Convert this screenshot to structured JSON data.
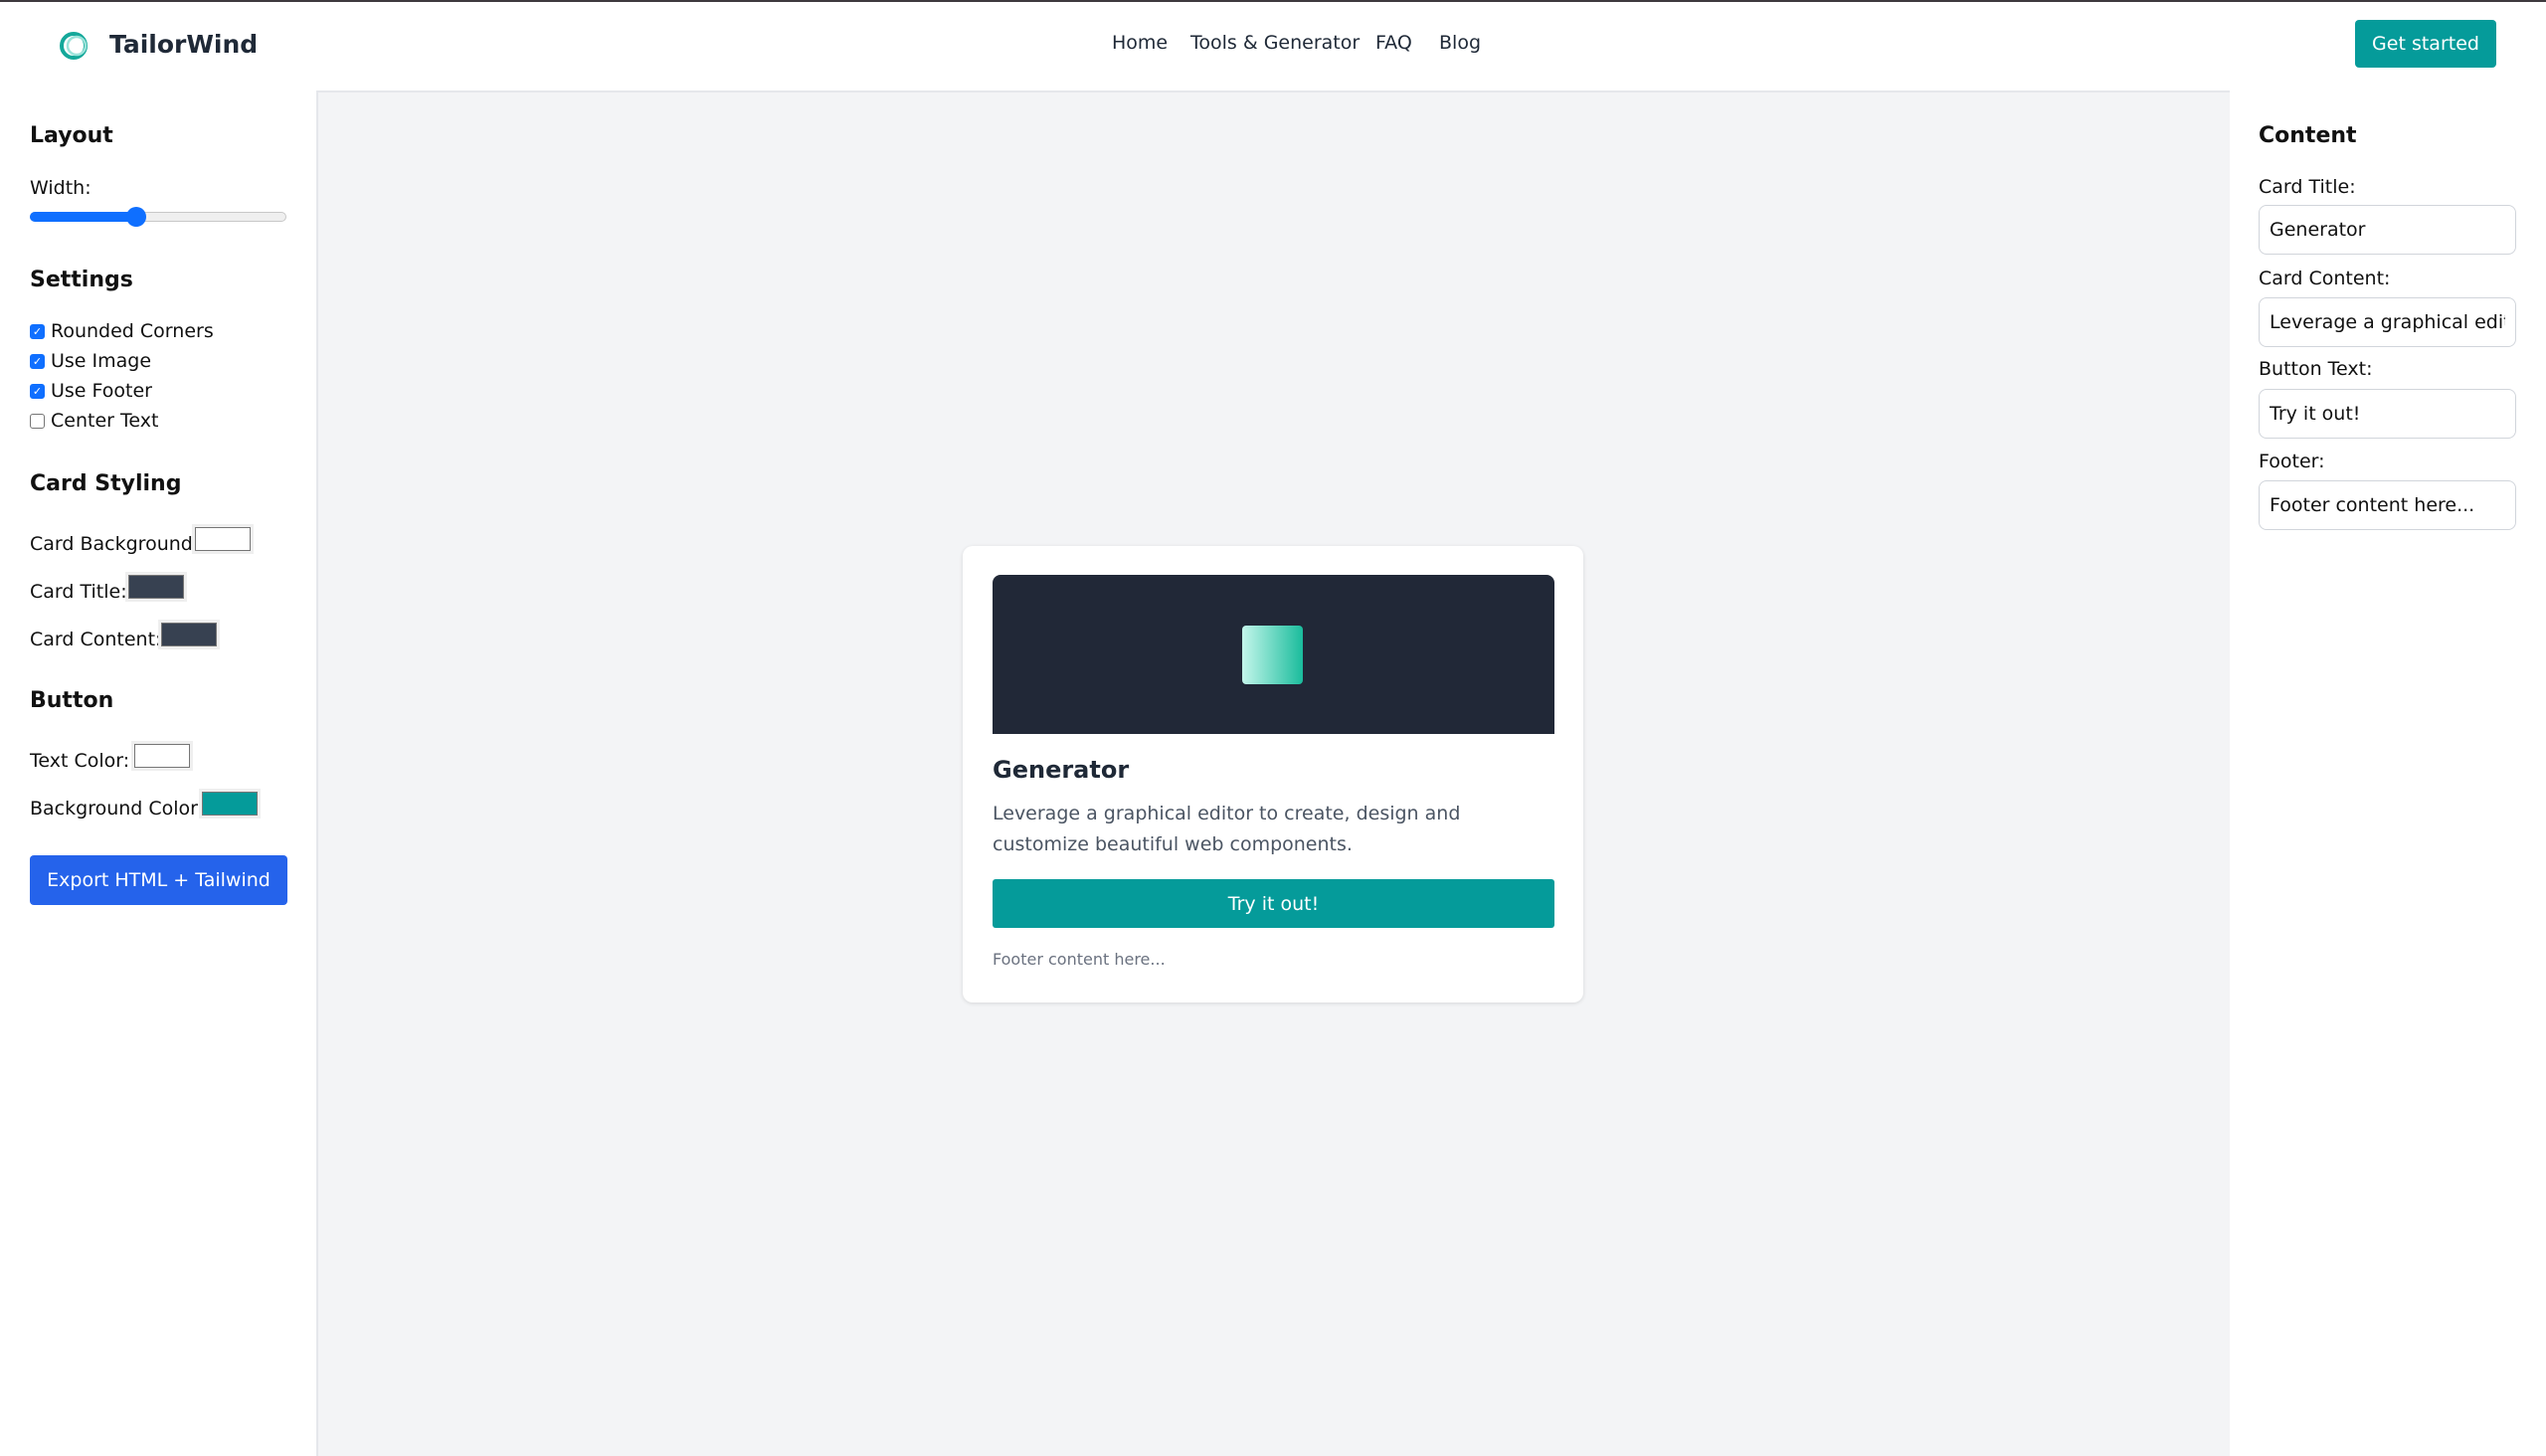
{
  "header": {
    "brand": "TailorWind",
    "nav": [
      "Home",
      "Tools & Generator",
      "FAQ",
      "Blog"
    ],
    "cta": "Get started",
    "accent": "#059b9a"
  },
  "left": {
    "layout_heading": "Layout",
    "width_label": "Width:",
    "width_value_percent": 40,
    "settings_heading": "Settings",
    "settings": [
      {
        "label": "Rounded Corners",
        "checked": true
      },
      {
        "label": "Use Image",
        "checked": true
      },
      {
        "label": "Use Footer",
        "checked": true
      },
      {
        "label": "Center Text",
        "checked": false
      }
    ],
    "card_styling_heading": "Card Styling",
    "card_colors": [
      {
        "label": "Card Background:",
        "color": "#ffffff"
      },
      {
        "label": "Card Title:",
        "color": "#374151"
      },
      {
        "label": "Card Content:",
        "color": "#374151"
      }
    ],
    "button_heading": "Button",
    "button_colors": [
      {
        "label": "Text Color:",
        "color": "#ffffff"
      },
      {
        "label": "Background Color:",
        "color": "#059b9a"
      }
    ],
    "export": "Export HTML + Tailwind"
  },
  "right": {
    "heading": "Content",
    "fields": [
      {
        "label": "Card Title:",
        "value": "Generator"
      },
      {
        "label": "Card Content:",
        "value": "Leverage a graphical editor to create, design and customize beautiful web components."
      },
      {
        "label": "Button Text:",
        "value": "Try it out!"
      },
      {
        "label": "Footer:",
        "value": "Footer content here..."
      }
    ]
  },
  "card": {
    "title": "Generator",
    "content": "Leverage a graphical editor to create, design and customize beautiful web components.",
    "button": "Try it out!",
    "footer": "Footer content here..."
  }
}
